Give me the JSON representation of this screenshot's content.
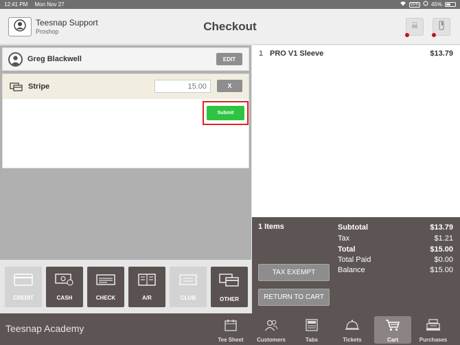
{
  "status_bar": {
    "time": "12:41 PM",
    "date": "Mon Nov 27",
    "vpn": "VPN",
    "battery": "45%"
  },
  "header": {
    "user_name": "Teesnap Support",
    "user_sub": "Proshop",
    "title": "Checkout"
  },
  "customer": {
    "name": "Greg Blackwell",
    "edit_label": "EDIT"
  },
  "payment": {
    "method": "Stripe",
    "amount_placeholder": "15.00",
    "remove_label": "X",
    "submit_label": "Submit"
  },
  "pay_methods": [
    {
      "label": "CREDIT",
      "icon": "credit-card-icon",
      "enabled": false
    },
    {
      "label": "CASH",
      "icon": "cash-icon",
      "enabled": true
    },
    {
      "label": "CHECK",
      "icon": "check-icon",
      "enabled": true
    },
    {
      "label": "A/R",
      "icon": "ledger-icon",
      "enabled": true
    },
    {
      "label": "CLUB",
      "icon": "ticket-icon",
      "enabled": false
    },
    {
      "label": "OTHER",
      "icon": "cards-icon",
      "enabled": true
    }
  ],
  "cart": {
    "items": [
      {
        "qty": "1",
        "name": "PRO V1 Sleeve",
        "price": "$13.79"
      }
    ]
  },
  "summary": {
    "items_count": "1 Items",
    "subtotal_label": "Subtotal",
    "subtotal": "$13.79",
    "tax_label": "Tax",
    "tax": "$1.21",
    "total_label": "Total",
    "total": "$15.00",
    "total_paid_label": "Total Paid",
    "total_paid": "$0.00",
    "balance_label": "Balance",
    "balance": "$15.00",
    "tax_exempt_label": "TAX EXEMPT",
    "return_label": "RETURN TO CART"
  },
  "footer": {
    "brand": "Teesnap Academy",
    "nav": [
      {
        "label": "Tee Sheet",
        "icon": "calendar-icon",
        "active": false
      },
      {
        "label": "Customers",
        "icon": "people-icon",
        "active": false
      },
      {
        "label": "Tabs",
        "icon": "register-icon",
        "active": false
      },
      {
        "label": "Tickets",
        "icon": "bell-icon",
        "active": false
      },
      {
        "label": "Cart",
        "icon": "cart-icon",
        "active": true
      },
      {
        "label": "Purchases",
        "icon": "cash-register-icon",
        "active": false
      }
    ]
  },
  "colors": {
    "accent_green": "#2ec442",
    "highlight_red": "#e02121",
    "dark_panel": "#5d5553"
  }
}
